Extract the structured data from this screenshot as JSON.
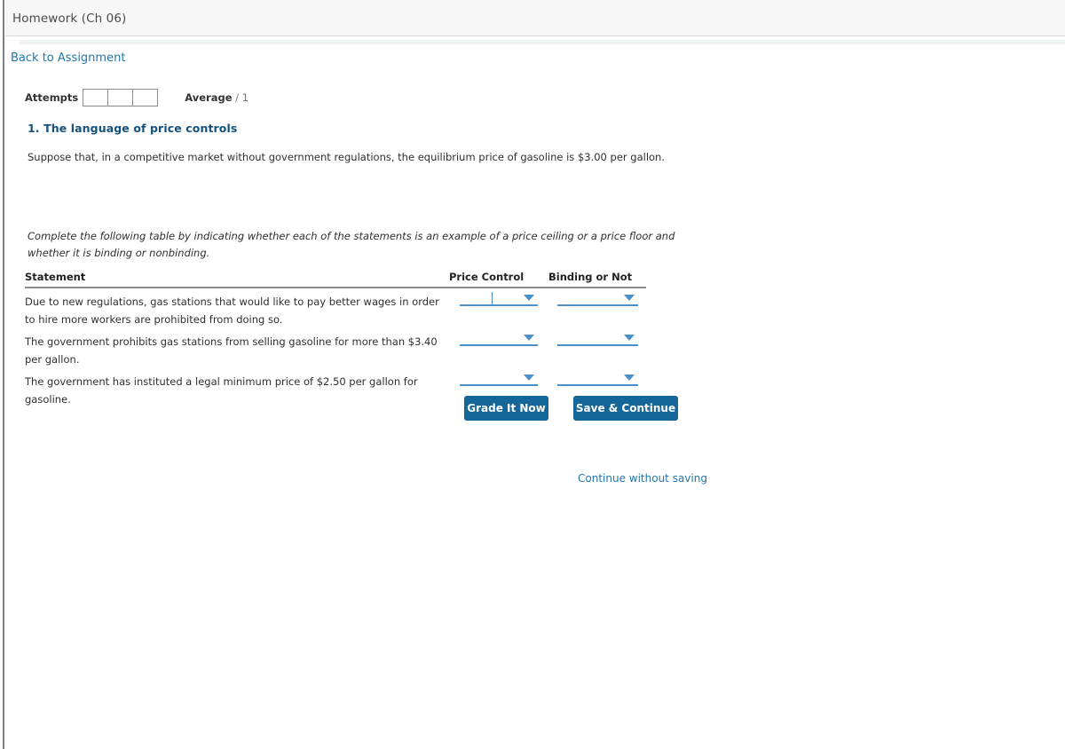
{
  "window": {
    "title": "Homework (Ch 06)"
  },
  "nav": {
    "back_link": "Back to Assignment"
  },
  "attempts": {
    "label": "Attempts",
    "boxes": [
      "",
      "",
      ""
    ],
    "average_label": "Average",
    "average_value": "/ 1"
  },
  "question": {
    "title": "1. The language of price controls",
    "intro": "Suppose that, in a competitive market without government regulations, the equilibrium price of gasoline is $3.00 per gallon.",
    "instruction": "Complete the following table by indicating whether each of the statements is an example of a price ceiling or a price floor and whether it is binding or nonbinding."
  },
  "table": {
    "headers": {
      "statement": "Statement",
      "price_control": "Price Control",
      "binding": "Binding or Not"
    },
    "rows": [
      {
        "statement": "Due to new regulations, gas stations that would like to pay better wages in order to hire more workers are prohibited from doing so.",
        "price_control_value": "",
        "binding_value": ""
      },
      {
        "statement": "The government prohibits gas stations from selling gasoline for more than $3.40 per gallon.",
        "price_control_value": "",
        "binding_value": ""
      },
      {
        "statement": "The government has instituted a legal minimum price of $2.50 per gallon for gasoline.",
        "price_control_value": "",
        "binding_value": ""
      }
    ]
  },
  "actions": {
    "grade_label": "Grade It Now",
    "save_label": "Save & Continue",
    "continue_without_saving_label": "Continue without saving"
  },
  "colors": {
    "brand_blue": "#15679a",
    "link_blue": "#2277ac",
    "heading_blue": "#14527e",
    "underline_blue": "#4a8fc8",
    "header_bg": "#f7f7f7"
  }
}
